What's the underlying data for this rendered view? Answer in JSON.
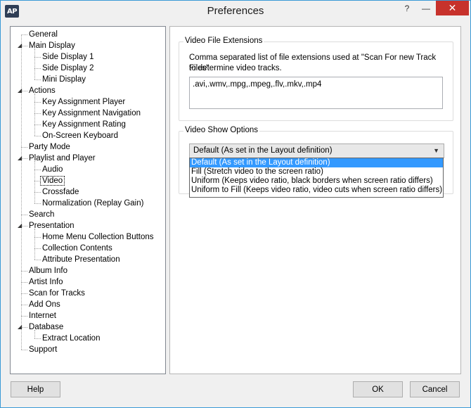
{
  "window": {
    "title": "Preferences",
    "logo_text": "AP",
    "help_glyph": "?",
    "minimize_glyph": "—",
    "close_glyph": "✕"
  },
  "tree": {
    "items": [
      {
        "label": "General",
        "level": 0
      },
      {
        "label": "Main Display",
        "level": 0,
        "expanded": true
      },
      {
        "label": "Side Display 1",
        "level": 1
      },
      {
        "label": "Side Display 2",
        "level": 1
      },
      {
        "label": "Mini Display",
        "level": 1
      },
      {
        "label": "Actions",
        "level": 0,
        "expanded": true
      },
      {
        "label": "Key Assignment Player",
        "level": 1
      },
      {
        "label": "Key Assignment Navigation",
        "level": 1
      },
      {
        "label": "Key Assignment Rating",
        "level": 1
      },
      {
        "label": "On-Screen Keyboard",
        "level": 1
      },
      {
        "label": "Party Mode",
        "level": 0
      },
      {
        "label": "Playlist and Player",
        "level": 0,
        "expanded": true
      },
      {
        "label": "Audio",
        "level": 1
      },
      {
        "label": "Video",
        "level": 1,
        "selected": true
      },
      {
        "label": "Crossfade",
        "level": 1
      },
      {
        "label": "Normalization (Replay Gain)",
        "level": 1
      },
      {
        "label": "Search",
        "level": 0
      },
      {
        "label": "Presentation",
        "level": 0,
        "expanded": true
      },
      {
        "label": "Home Menu Collection Buttons",
        "level": 1
      },
      {
        "label": "Collection Contents",
        "level": 1
      },
      {
        "label": "Attribute Presentation",
        "level": 1
      },
      {
        "label": "Album Info",
        "level": 0
      },
      {
        "label": "Artist Info",
        "level": 0
      },
      {
        "label": "Scan for Tracks",
        "level": 0
      },
      {
        "label": "Add Ons",
        "level": 0
      },
      {
        "label": "Internet",
        "level": 0
      },
      {
        "label": "Database",
        "level": 0,
        "expanded": true
      },
      {
        "label": "Extract Location",
        "level": 1
      },
      {
        "label": "Support",
        "level": 0
      }
    ]
  },
  "video_ext": {
    "group_title": "Video File Extensions",
    "description_line1": "Comma separated list of file extensions used at \"Scan For new Track Files\"",
    "description_line2": "to determine video tracks.",
    "value": ".avi,.wmv,.mpg,.mpeg,.flv,.mkv,.mp4"
  },
  "video_show": {
    "group_title": "Video Show Options",
    "selected": "Default (As set in the Layout definition)",
    "options": [
      "Default (As set in the Layout definition)",
      "Fill (Stretch video to the screen ratio)",
      "Uniform (Keeps video ratio, black borders when screen ratio differs)",
      "Uniform to Fill (Keeps video ratio, video cuts when screen ratio differs)"
    ]
  },
  "buttons": {
    "help": "Help",
    "ok": "OK",
    "cancel": "Cancel"
  }
}
